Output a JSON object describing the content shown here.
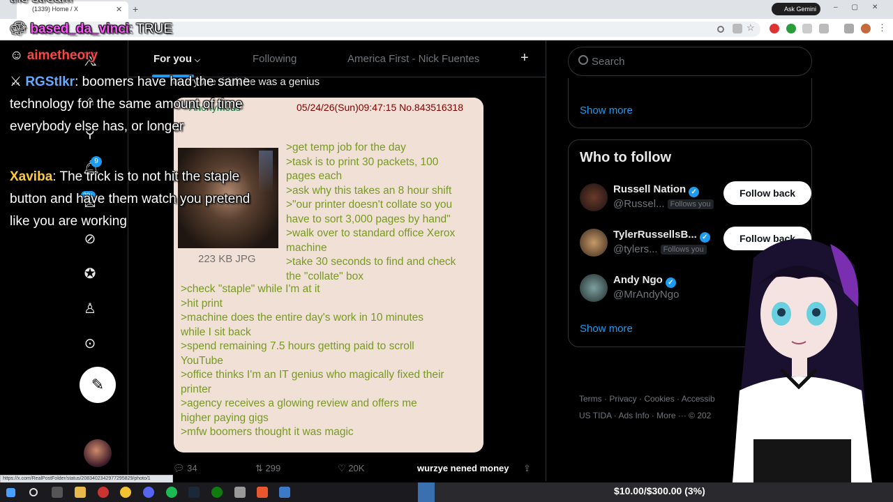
{
  "browser": {
    "tab_title": "(1339) Home / X",
    "gemini_label": "Ask Gemini",
    "status_url": "https://x.com/RealPostFolder/status/2083402342977295829/photo/1"
  },
  "x_nav": {
    "notification_count": "9",
    "messages_count": "20+"
  },
  "feed": {
    "tabs": [
      "For you",
      "Following",
      "America First - Nick Fuentes"
    ],
    "plus": "+",
    "tweet_text": "everyone think he was a genius",
    "post": {
      "name": "Anonymous",
      "meta": "05/24/26(Sun)09:47:15 No.843516318",
      "thumb_caption": "223 KB JPG",
      "greentext_right": ">get temp job for the day\n>task is to print 30 packets, 100\npages each\n>ask why this takes an 8 hour shift\n>\"our printer doesn't collate so you\nhave to sort 3,000 pages by hand\"\n>walk over to standard office Xerox\nmachine\n>take 30 seconds to find and check\nthe \"collate\" box",
      "greentext_full": ">check \"staple\" while I'm at it\n>hit print\n>machine does the entire day's work in 10 minutes\nwhile I sit back\n>spend remaining 7.5 hours getting paid to scroll\nYouTube\n>office thinks I'm an IT genius who magically fixed their\nprinter\n>agency receives a glowing review and offers me\nhigher paying gigs\n>mfw boomers thought it was magic"
    },
    "actions": {
      "replies": "34",
      "reposts": "299",
      "likes": "20K"
    }
  },
  "right": {
    "search_placeholder": "Search",
    "show_more": "Show more",
    "who_to_follow_title": "Who to follow",
    "suggestions": [
      {
        "name": "Russell Nation",
        "handle": "@Russel...",
        "follows_you": "Follows you",
        "button": "Follow back"
      },
      {
        "name": "TylerRussellsB...",
        "handle": "@tylers...",
        "follows_you": "Follows you",
        "button": "Follow back"
      },
      {
        "name": "Andy Ngo",
        "handle": "@MrAndyNgo",
        "follows_you": "",
        "button": ""
      }
    ],
    "footer": {
      "line1": "Terms  ·  Privacy  ·  Cookies  ·  Accessib",
      "line2": "US TIDA  ·  Ads Info  ·  More ···  © 202"
    }
  },
  "chat": [
    {
      "user": "based_da_vinci",
      "msg": ": TRUE",
      "color": "#ff55ff"
    },
    {
      "user": "aimetheory",
      "msg": "",
      "color": "#ff4444"
    },
    {
      "user": "RGStlkr",
      "msg": ": boomers have had the same technology for the same amount of time everybody else has, or longer",
      "color": "#66aaff"
    },
    {
      "user": "Xaviba",
      "msg": ": The trick is to not hit the staple button and have them watch you pretend like you are working",
      "color": "#ffcc33"
    }
  ],
  "chat_top_fragment": "the stream",
  "stream": {
    "money_caption": "wurzye nened money",
    "goal_text": "$10.00/$300.00 (3%)",
    "goal_fraction": 0.03
  }
}
